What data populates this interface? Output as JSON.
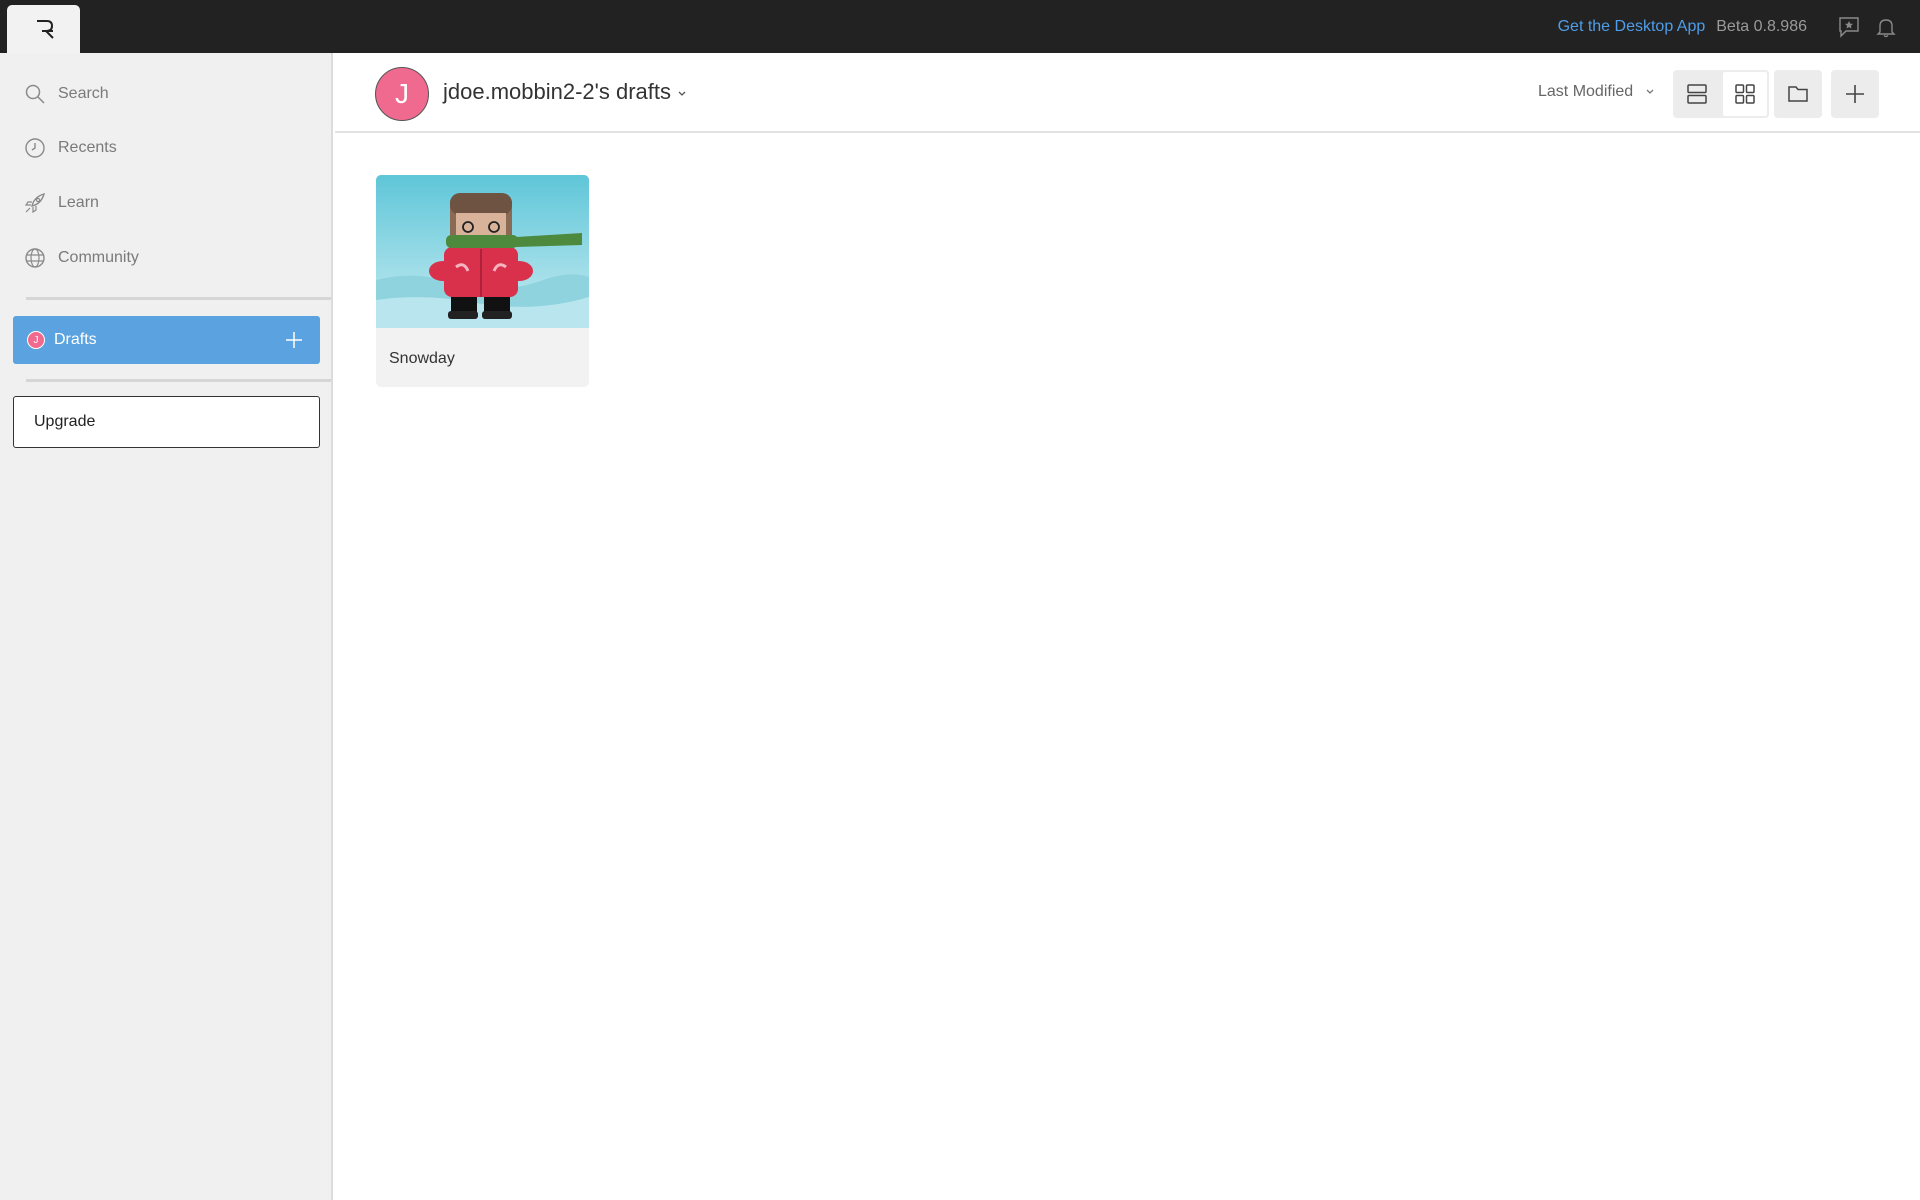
{
  "app": {
    "logo_icon": "r-logo-icon"
  },
  "topbar": {
    "desktop_app_link": "Get the Desktop App",
    "version": "Beta 0.8.986",
    "feedback_icon": "feedback-icon",
    "notifications_icon": "bell-icon",
    "link_color": "#4f9de8"
  },
  "sidebar": {
    "items": [
      {
        "label": "Search",
        "icon": "search-icon"
      },
      {
        "label": "Recents",
        "icon": "clock-icon"
      },
      {
        "label": "Learn",
        "icon": "rocket-icon"
      },
      {
        "label": "Community",
        "icon": "globe-icon"
      }
    ],
    "drafts": {
      "avatar_letter": "J",
      "label": "Drafts",
      "accent": "#5aa2e0"
    },
    "upgrade_label": "Upgrade"
  },
  "header": {
    "avatar_letter": "J",
    "avatar_color": "#f06a8f",
    "title": "jdoe.mobbin2-2's drafts",
    "sort_label": "Last Modified",
    "view_mode": "grid"
  },
  "files": [
    {
      "name": "Snowday",
      "thumbnail": "snowday-character-thumbnail"
    }
  ]
}
